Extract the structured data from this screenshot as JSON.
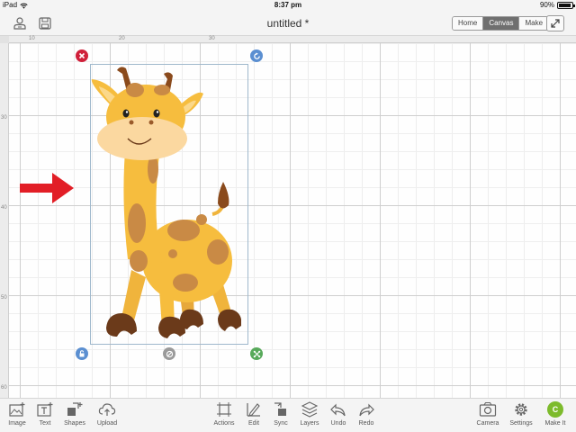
{
  "status": {
    "device": "iPad",
    "time": "8:37 pm",
    "battery": "90%",
    "battery_level": 0.9
  },
  "header": {
    "title": "untitled *",
    "modes": [
      {
        "label": "Home",
        "active": false
      },
      {
        "label": "Canvas",
        "active": true
      },
      {
        "label": "Make",
        "active": false
      }
    ]
  },
  "ruler": {
    "top": [
      "10",
      "20",
      "30"
    ],
    "left": [
      "30",
      "40",
      "50",
      "60"
    ]
  },
  "canvas": {
    "arrow_color": "#e21e26",
    "handles": {
      "delete": {
        "icon": "close-icon",
        "color": "#d0203a"
      },
      "rotate": {
        "icon": "rotate-icon",
        "color": "#5b8fd1"
      },
      "lock": {
        "icon": "lock-icon",
        "color": "#5b8fd1"
      },
      "unlink": {
        "icon": "unlink-icon",
        "color": "#9a9a9a"
      },
      "resize": {
        "icon": "resize-icon",
        "color": "#57a95a"
      }
    }
  },
  "toolbar": {
    "left": [
      {
        "label": "Image",
        "icon": "image-icon"
      },
      {
        "label": "Text",
        "icon": "text-icon"
      },
      {
        "label": "Shapes",
        "icon": "shapes-icon"
      },
      {
        "label": "Upload",
        "icon": "upload-icon"
      }
    ],
    "center": [
      {
        "label": "Actions",
        "icon": "actions-icon"
      },
      {
        "label": "Edit",
        "icon": "edit-icon"
      },
      {
        "label": "Sync",
        "icon": "sync-icon"
      },
      {
        "label": "Layers",
        "icon": "layers-icon"
      },
      {
        "label": "Undo",
        "icon": "undo-icon"
      },
      {
        "label": "Redo",
        "icon": "redo-icon"
      }
    ],
    "right": [
      {
        "label": "Camera",
        "icon": "camera-icon"
      },
      {
        "label": "Settings",
        "icon": "settings-icon"
      },
      {
        "label": "Make It",
        "icon": "make-it-icon",
        "glyph": "C",
        "color": "#7dbb2c"
      }
    ]
  }
}
